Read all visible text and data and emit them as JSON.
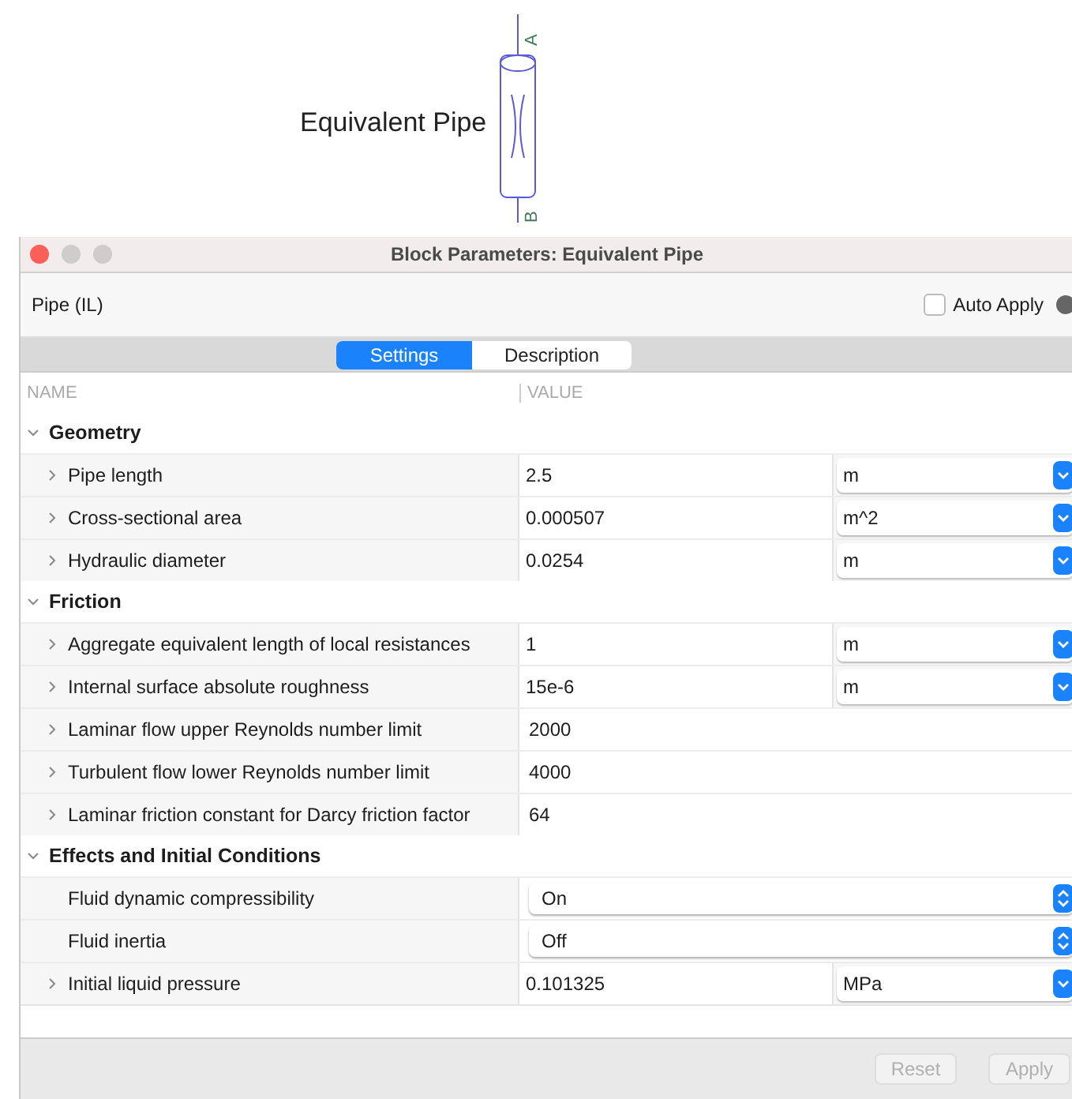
{
  "diagram": {
    "label": "Equivalent Pipe",
    "ports": [
      "A",
      "B"
    ]
  },
  "window": {
    "title": "Block Parameters: Equivalent Pipe"
  },
  "header": {
    "block_name": "Pipe (IL)",
    "auto_apply": {
      "label": "Auto Apply",
      "checked": false
    }
  },
  "tabs": [
    {
      "label": "Settings",
      "selected": true
    },
    {
      "label": "Description",
      "selected": false
    }
  ],
  "table": {
    "columns": [
      "NAME",
      "VALUE"
    ],
    "groups": [
      {
        "name": "Geometry",
        "expanded": true,
        "rows": [
          {
            "kind": "unit",
            "name": "Pipe length",
            "expandable": true,
            "value": "2.5",
            "unit": "m"
          },
          {
            "kind": "unit",
            "name": "Cross-sectional area",
            "expandable": true,
            "value": "0.000507",
            "unit": "m^2"
          },
          {
            "kind": "unit",
            "name": "Hydraulic diameter",
            "expandable": true,
            "value": "0.0254",
            "unit": "m"
          }
        ]
      },
      {
        "name": "Friction",
        "expanded": true,
        "rows": [
          {
            "kind": "unit",
            "name": "Aggregate equivalent length of local resistances",
            "expandable": true,
            "value": "1",
            "unit": "m"
          },
          {
            "kind": "unit",
            "name": "Internal surface absolute roughness",
            "expandable": true,
            "value": "15e-6",
            "unit": "m"
          },
          {
            "kind": "value",
            "name": "Laminar flow upper Reynolds number limit",
            "expandable": true,
            "value": "2000"
          },
          {
            "kind": "value",
            "name": "Turbulent flow lower Reynolds number limit",
            "expandable": true,
            "value": "4000"
          },
          {
            "kind": "value",
            "name": "Laminar friction constant for Darcy friction factor",
            "expandable": true,
            "value": "64"
          }
        ]
      },
      {
        "name": "Effects and Initial Conditions",
        "expanded": true,
        "rows": [
          {
            "kind": "select",
            "name": "Fluid dynamic compressibility",
            "expandable": false,
            "value": "On"
          },
          {
            "kind": "select",
            "name": "Fluid inertia",
            "expandable": false,
            "value": "Off"
          },
          {
            "kind": "unit",
            "name": "Initial liquid pressure",
            "expandable": true,
            "value": "0.101325",
            "unit": "MPa"
          }
        ]
      }
    ]
  },
  "buttons": [
    {
      "label": "Reset",
      "disabled": true
    },
    {
      "label": "Apply",
      "disabled": true
    }
  ]
}
